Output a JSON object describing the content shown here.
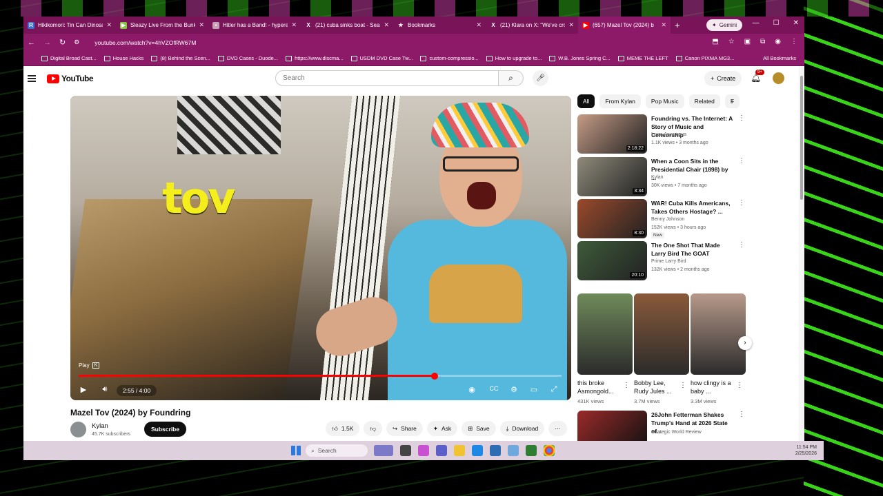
{
  "browser": {
    "tabs": [
      {
        "title": "Hikikomori: Tin Can Dinosau",
        "icon": "r-icon",
        "color": "#3a6fd8",
        "glyph": "R"
      },
      {
        "title": "Sleazy Live From the Bunker",
        "icon": "rumble-icon",
        "color": "#85c742",
        "glyph": "▶"
      },
      {
        "title": "Hitler has a Band! - hypere",
        "icon": "page-icon",
        "color": "#c9a0b8",
        "glyph": "▪"
      },
      {
        "title": "(21) cuba sinks boat - Searc",
        "icon": "x-icon",
        "color": "#7a1458",
        "glyph": "X"
      },
      {
        "title": "Bookmarks",
        "icon": "star-icon",
        "color": "#7a1458",
        "glyph": "★"
      },
      {
        "title": "(21) Klara on X: \"We've cross",
        "icon": "x-icon",
        "color": "#7a1458",
        "glyph": "X"
      },
      {
        "title": "(657) Mazel Tov (2024) b",
        "icon": "youtube-icon",
        "color": "#ff0000",
        "glyph": "▶"
      }
    ],
    "gemini_label": "Gemini",
    "url": "youtube.com/watch?v=4hVZOfRW67M",
    "bookmarks": [
      "Digital Broad Cast...",
      "House Hacks",
      "(8) Behind the Scen...",
      "DVD Cases - Duode...",
      "https://www.discma...",
      "USDM DVD Case Tw...",
      "custom-compressio...",
      "How to upgrade to...",
      "W.B. Jones Spring C...",
      "MEME THE LEFT",
      "Canon PIXMA MG3..."
    ],
    "all_bookmarks": "All Bookmarks"
  },
  "youtube": {
    "logo": "YouTube",
    "search_placeholder": "Search",
    "create_label": "Create",
    "notif_count": "9+"
  },
  "video": {
    "overlay_text": "tov",
    "play_tooltip": "Play",
    "play_key": "K",
    "progress": 0.7375,
    "time": "2:55 / 4:00",
    "title": "Mazel Tov (2024) by Foundring",
    "channel": "Kylan",
    "subscribers": "45.7K subscribers",
    "subscribe_label": "Subscribe",
    "likes": "1.5K",
    "share_label": "Share",
    "ask_label": "Ask",
    "save_label": "Save",
    "download_label": "Download"
  },
  "chips": [
    "All",
    "From Kylan",
    "Pop Music",
    "Related",
    "F"
  ],
  "recommendations": [
    {
      "title": "Foundring vs. The Internet: A Story of Music and Censorship",
      "channel": "Luiza Asyamova",
      "views": "1.1K views • 3 months ago",
      "duration": "2:18:22",
      "thumb": "#c59c86"
    },
    {
      "title": "When a Coon Sits in the Presidential Chair (1898) by ...",
      "channel": "Kylan",
      "views": "30K views • 7 months ago",
      "duration": "3:34",
      "thumb": "#8f8a7a"
    },
    {
      "title": "WAR! Cuba Kills Americans, Takes Others Hostage? ...",
      "channel": "Benny Johnson",
      "views": "152K views • 3 hours ago",
      "duration": "8:30",
      "thumb": "#9b4a2c",
      "badge": "New"
    },
    {
      "title": "The One Shot That Made Larry Bird The GOAT",
      "channel": "Prime Larry Bird",
      "views": "132K views • 2 months ago",
      "duration": "20:10",
      "thumb": "#3e5a3a"
    }
  ],
  "shorts": [
    {
      "title": "this broke Asmongold...",
      "views": "431K views",
      "color": "#6f8a5a"
    },
    {
      "title": "Bobby Lee, Rudy Jules ...",
      "views": "3.7M views",
      "color": "#8a5a3a"
    },
    {
      "title": "how clingy is a baby ...",
      "views": "3.3M views",
      "color": "#b7998a"
    }
  ],
  "next_rec": {
    "title": "26John Fetterman Shakes Trump's Hand at 2026 State of...",
    "channel": "Strategic World Review",
    "thumb": "#9a2a2a"
  },
  "taskbar": {
    "search_label": "Search",
    "time": "11:54 PM",
    "date": "2/25/2026"
  }
}
